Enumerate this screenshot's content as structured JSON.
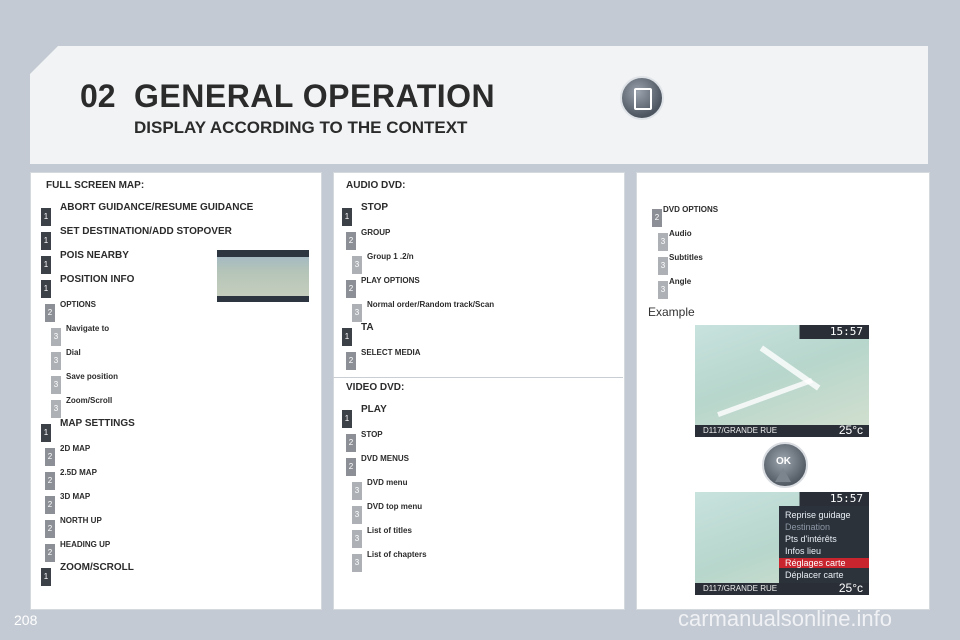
{
  "header": {
    "chapter": "02",
    "title": "GENERAL OPERATION",
    "subtitle": "DISPLAY ACCORDING TO THE CONTEXT"
  },
  "full_screen_map": {
    "heading": "FULL SCREEN MAP:",
    "items": [
      {
        "level": "1",
        "label": "ABORT GUIDANCE/RESUME GUIDANCE"
      },
      {
        "level": "1",
        "label": "SET DESTINATION/ADD STOPOVER"
      },
      {
        "level": "1",
        "label": "POIS NEARBY"
      },
      {
        "level": "1",
        "label": "POSITION INFO"
      },
      {
        "level": "2",
        "label": "OPTIONS"
      },
      {
        "level": "3",
        "label": "Navigate to"
      },
      {
        "level": "3",
        "label": "Dial"
      },
      {
        "level": "3",
        "label": "Save position"
      },
      {
        "level": "3",
        "label": "Zoom/Scroll"
      },
      {
        "level": "1",
        "label": "MAP SETTINGS"
      },
      {
        "level": "2",
        "label": "2D MAP"
      },
      {
        "level": "2",
        "label": "2.5D MAP"
      },
      {
        "level": "2",
        "label": "3D MAP"
      },
      {
        "level": "2",
        "label": "NORTH UP"
      },
      {
        "level": "2",
        "label": "HEADING UP"
      },
      {
        "level": "1",
        "label": "ZOOM/SCROLL"
      }
    ]
  },
  "audio_dvd": {
    "heading": "AUDIO DVD:",
    "items": [
      {
        "level": "1",
        "label": "STOP"
      },
      {
        "level": "2",
        "label": "GROUP"
      },
      {
        "level": "3",
        "label": "Group 1 .2/n"
      },
      {
        "level": "2",
        "label": "PLAY OPTIONS"
      },
      {
        "level": "3",
        "label": "Normal order/Random track/Scan"
      },
      {
        "level": "1",
        "label": "TA"
      },
      {
        "level": "2",
        "label": "SELECT MEDIA"
      }
    ]
  },
  "video_dvd": {
    "heading": "VIDEO DVD:",
    "items": [
      {
        "level": "1",
        "label": "PLAY"
      },
      {
        "level": "2",
        "label": "STOP"
      },
      {
        "level": "2",
        "label": "DVD MENUS"
      },
      {
        "level": "3",
        "label": "DVD menu"
      },
      {
        "level": "3",
        "label": "DVD top menu"
      },
      {
        "level": "3",
        "label": "List of titles"
      },
      {
        "level": "3",
        "label": "List of chapters"
      }
    ]
  },
  "dvd_options": {
    "items": [
      {
        "level": "2",
        "label": "DVD OPTIONS"
      },
      {
        "level": "3",
        "label": "Audio"
      },
      {
        "level": "3",
        "label": "Subtitles"
      },
      {
        "level": "3",
        "label": "Angle"
      }
    ]
  },
  "example": {
    "label": "Example",
    "clock": "15:57",
    "road": "D117/GRANDE RUE",
    "temp": "25°c",
    "knob_label": "OK",
    "menu": [
      "Reprise guidage",
      "Destination",
      "Pts d'intérêts",
      "Infos lieu",
      "Réglages carte",
      "Déplacer carte"
    ],
    "menu_selected": "Réglages carte"
  },
  "page_number": "208",
  "watermark": "carmanualsonline.info",
  "colors": {
    "level1": "#3c4047",
    "level2": "#8c9096",
    "level3": "#adb1b6",
    "menu_highlight": "#c9252f"
  }
}
